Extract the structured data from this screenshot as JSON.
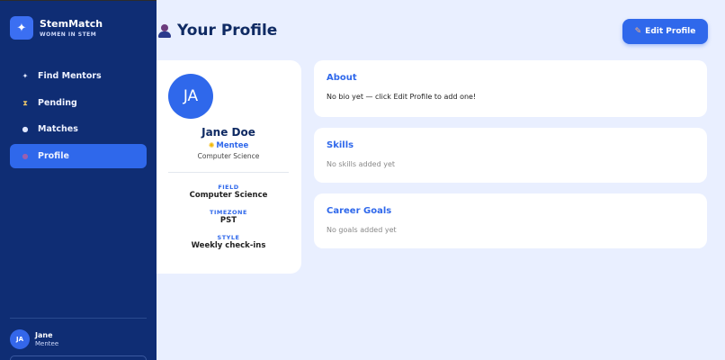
{
  "brand": {
    "name": "StemMatch",
    "tagline": "WOMEN IN STEM",
    "icon": "sparkle-icon"
  },
  "nav": [
    {
      "label": "Find Mentors",
      "icon": "sparkle-icon",
      "active": false
    },
    {
      "label": "Pending",
      "icon": "hourglass-icon",
      "active": false
    },
    {
      "label": "Matches",
      "icon": "chat-bubble-icon",
      "active": false
    },
    {
      "label": "Profile",
      "icon": "person-icon",
      "active": true
    }
  ],
  "current_user": {
    "initials": "JA",
    "name": "Jane",
    "role": "Mentee"
  },
  "page": {
    "title": "Your Profile",
    "edit_button": "Edit Profile"
  },
  "profile": {
    "initials": "JA",
    "name": "Jane Doe",
    "role": "Mentee",
    "department": "Computer Science",
    "fields": [
      {
        "label": "FIELD",
        "value": "Computer Science"
      },
      {
        "label": "TIMEZONE",
        "value": "PST"
      },
      {
        "label": "STYLE",
        "value": "Weekly check-ins"
      }
    ]
  },
  "sections": {
    "about": {
      "title": "About",
      "text": "No bio yet — click Edit Profile to add one!"
    },
    "skills": {
      "title": "Skills",
      "text": "No skills added yet"
    },
    "goals": {
      "title": "Career Goals",
      "text": "No goals added yet"
    }
  },
  "colors": {
    "sidebar": "#0f2d74",
    "accent": "#2f68eb",
    "background": "#e9efff",
    "heading": "#0f2a63"
  }
}
